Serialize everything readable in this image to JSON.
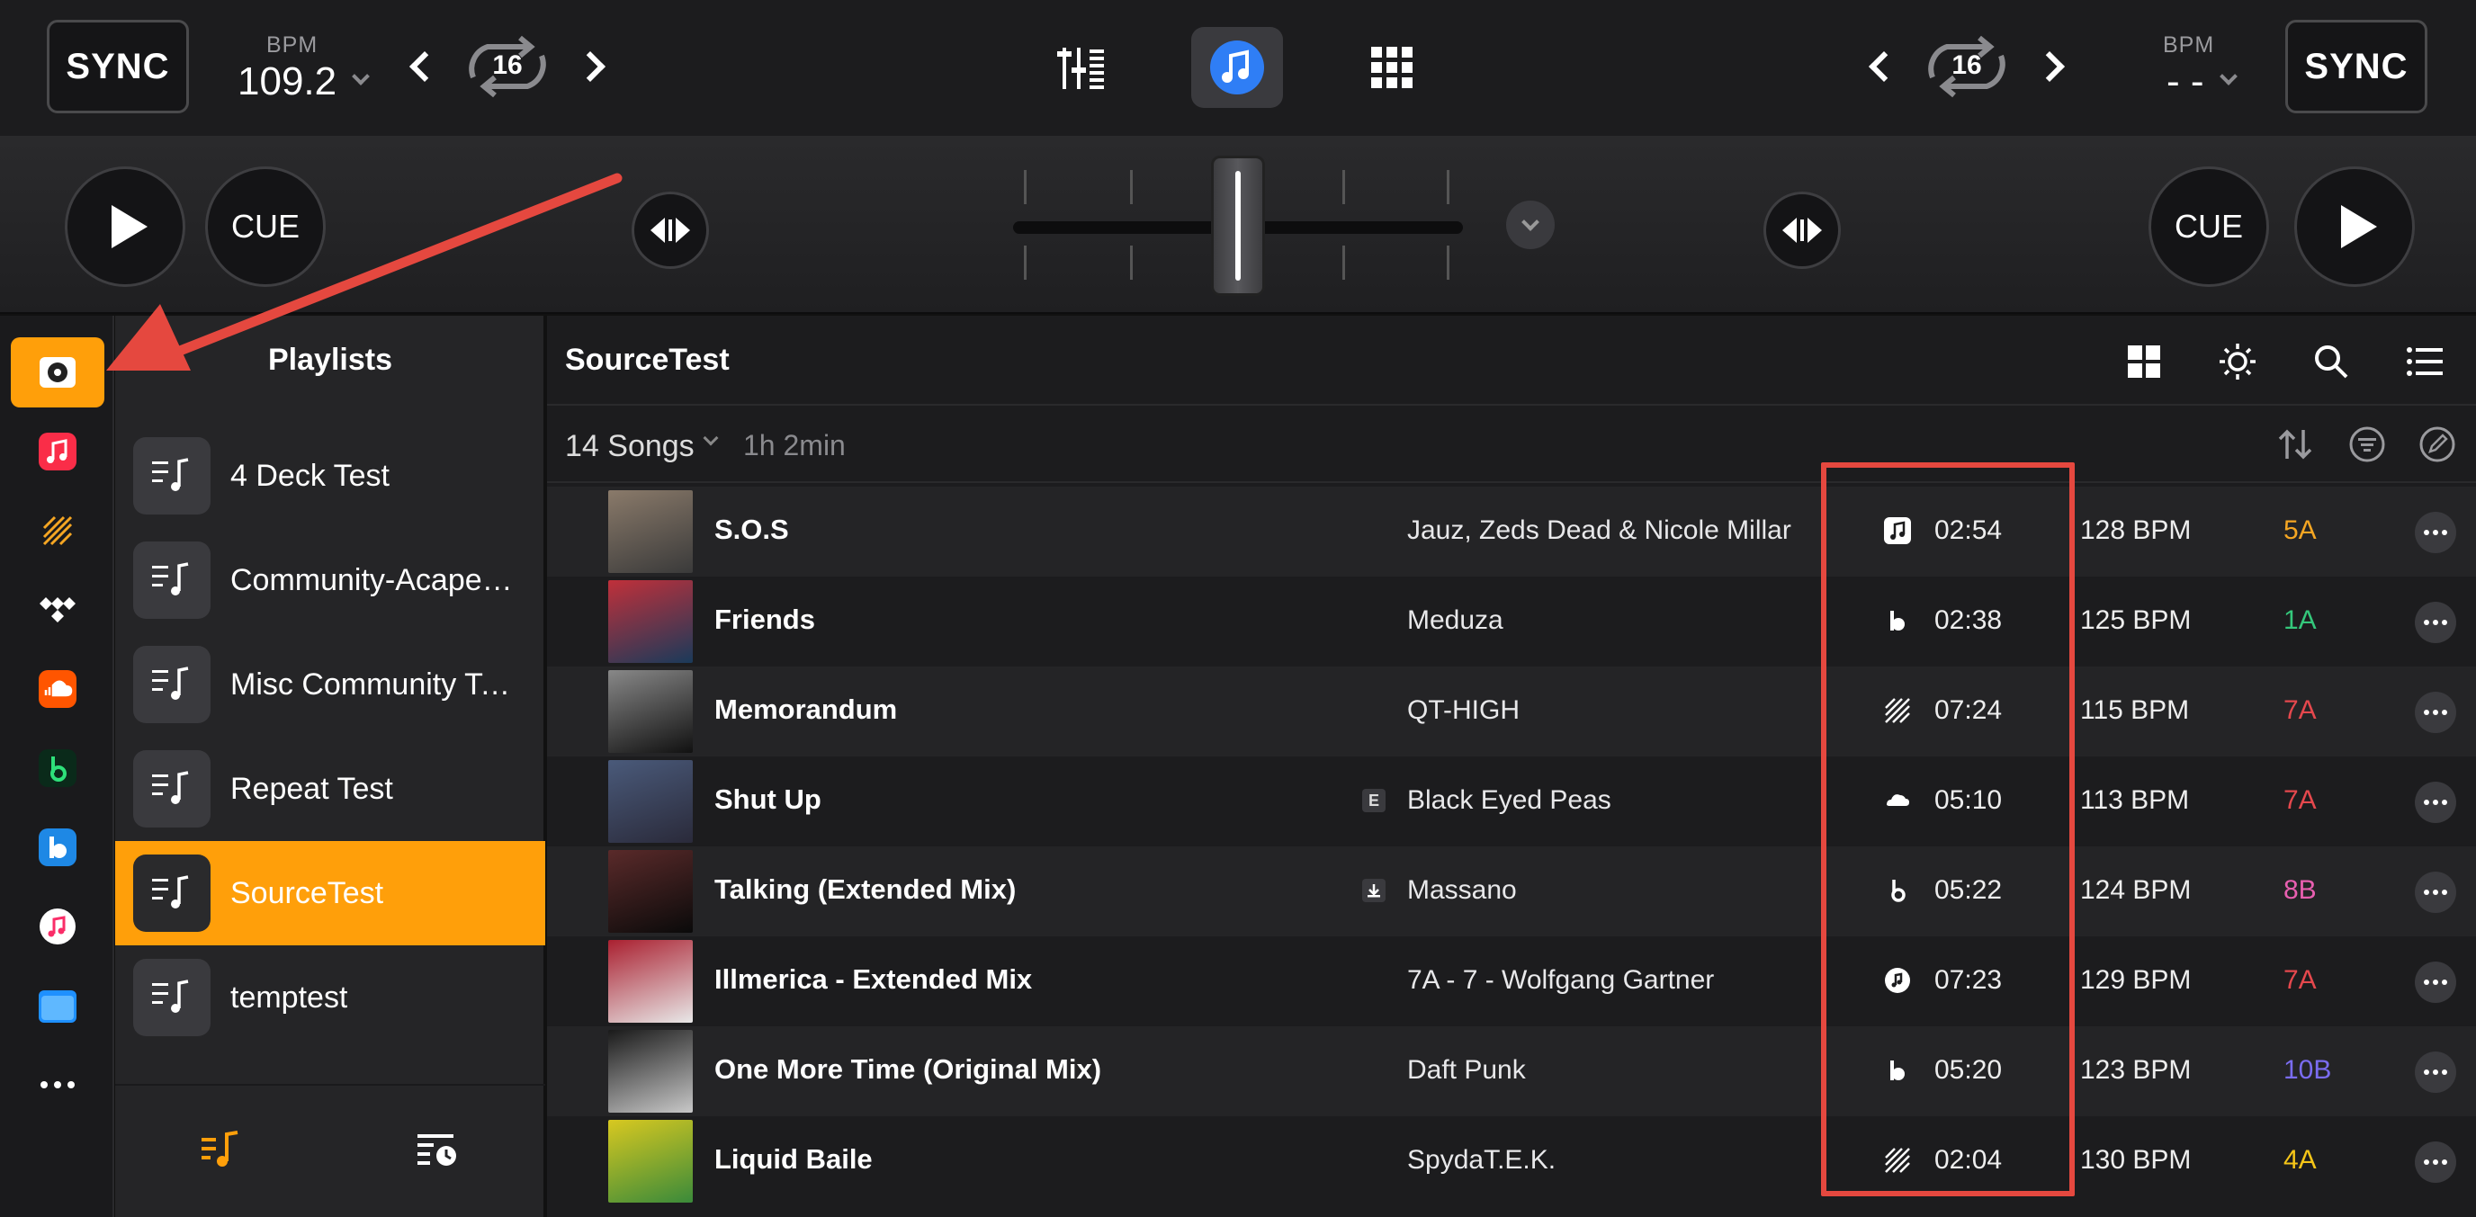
{
  "deck_left": {
    "sync_label": "SYNC",
    "bpm_label": "BPM",
    "bpm_value": "109.2",
    "loop_value": "16",
    "cue_label": "CUE"
  },
  "deck_right": {
    "sync_label": "SYNC",
    "bpm_label": "BPM",
    "bpm_value": "- -",
    "loop_value": "16",
    "cue_label": "CUE"
  },
  "center_tabs": [
    "mixer-icon",
    "music-note-icon",
    "grid-icon"
  ],
  "sources": [
    "local-library-icon",
    "apple-music-icon",
    "beatport-icon",
    "tidal-icon",
    "soundcloud-icon",
    "beatsource-icon",
    "beatport-link-icon",
    "itunes-icon",
    "files-icon",
    "more-icon"
  ],
  "playlists": {
    "title": "Playlists",
    "items": [
      {
        "name": "4 Deck Test"
      },
      {
        "name": "Community-Acapell..."
      },
      {
        "name": "Misc Community Te..."
      },
      {
        "name": "Repeat Test"
      },
      {
        "name": "SourceTest",
        "active": true
      },
      {
        "name": "temptest"
      }
    ]
  },
  "main": {
    "title": "SourceTest",
    "song_count": "14 Songs",
    "total_duration": "1h 2min"
  },
  "songs": [
    {
      "title": "S.O.S",
      "artist": "Jauz, Zeds Dead & Nicole Millar",
      "source": "apple-music-icon",
      "time": "02:54",
      "bpm": "128 BPM",
      "key": "5A",
      "key_color": "#f5a623",
      "art": [
        "#8a7a6a",
        "#3a3a3a"
      ]
    },
    {
      "title": "Friends",
      "artist": "Meduza",
      "source": "beatport-link-icon",
      "time": "02:38",
      "bpm": "125 BPM",
      "key": "1A",
      "key_color": "#34c77b",
      "art": [
        "#c0303a",
        "#1a3a5a"
      ]
    },
    {
      "title": "Memorandum",
      "artist": "QT-HIGH",
      "source": "beatport-icon",
      "time": "07:24",
      "bpm": "115 BPM",
      "key": "7A",
      "key_color": "#e5484d",
      "art": [
        "#888",
        "#111"
      ]
    },
    {
      "title": "Shut Up",
      "badge": "E",
      "artist": "Black Eyed Peas",
      "source": "soundcloud-icon",
      "time": "05:10",
      "bpm": "113 BPM",
      "key": "7A",
      "key_color": "#e5484d",
      "art": [
        "#4a5a7a",
        "#2a2a3a"
      ]
    },
    {
      "title": "Talking (Extended Mix)",
      "badge": "download",
      "artist": "Massano",
      "source": "beatsource-icon",
      "time": "05:22",
      "bpm": "124 BPM",
      "key": "8B",
      "key_color": "#e85fb0",
      "art": [
        "#5a2a2a",
        "#0a0a0a"
      ]
    },
    {
      "title": "Illmerica - Extended Mix",
      "artist": "7A - 7 - Wolfgang Gartner",
      "source": "music-disc-icon",
      "time": "07:23",
      "bpm": "129 BPM",
      "key": "7A",
      "key_color": "#e5484d",
      "art": [
        "#aa2030",
        "#e8e8e8"
      ]
    },
    {
      "title": "One More Time (Original Mix)",
      "artist": "Daft Punk",
      "source": "beatport-link-icon",
      "time": "05:20",
      "bpm": "123 BPM",
      "key": "10B",
      "key_color": "#7a6cf0",
      "art": [
        "#1a1a1a",
        "#c8c8c8"
      ]
    },
    {
      "title": "Liquid Baile",
      "artist": "SpydaT.E.K.",
      "source": "beatport-icon",
      "time": "02:04",
      "bpm": "130 BPM",
      "key": "4A",
      "key_color": "#f5c518",
      "art": [
        "#d8c820",
        "#3a8a3a"
      ]
    }
  ],
  "colors": {
    "accent": "#ff9f0a",
    "annotation": "#e5483f",
    "music_tab": "#2f7ef5"
  }
}
